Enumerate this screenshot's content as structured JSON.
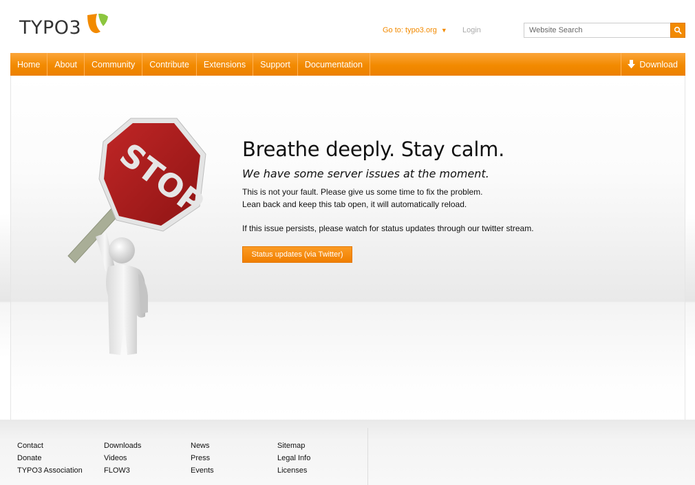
{
  "header": {
    "logo_text": "TYPO3",
    "goto_label": "Go to: typo3.org",
    "login_label": "Login",
    "search_placeholder": "Website Search"
  },
  "nav": {
    "items": [
      "Home",
      "About",
      "Community",
      "Contribute",
      "Extensions",
      "Support",
      "Documentation"
    ],
    "download_label": "Download"
  },
  "main": {
    "sign_text": "STOP",
    "headline": "Breathe deeply. Stay calm.",
    "subhead": "We have some server issues at the moment.",
    "line1": "This is not your fault. Please give us some time to fix the problem.",
    "line2": "Lean back and keep this tab open, it will automatically reload.",
    "line3": "If this issue persists, please watch for status updates through our twitter stream.",
    "button_label": "Status updates (via Twitter)"
  },
  "footer": {
    "columns": [
      [
        "Contact",
        "Donate",
        "TYPO3 Association"
      ],
      [
        "Downloads",
        "Videos",
        "FLOW3"
      ],
      [
        "News",
        "Press",
        "Events"
      ],
      [
        "Sitemap",
        "Legal Info",
        "Licenses"
      ]
    ]
  },
  "colors": {
    "accent": "#f28a00",
    "sign_red": "#a71f1f",
    "logo_green": "#8cc63f"
  }
}
